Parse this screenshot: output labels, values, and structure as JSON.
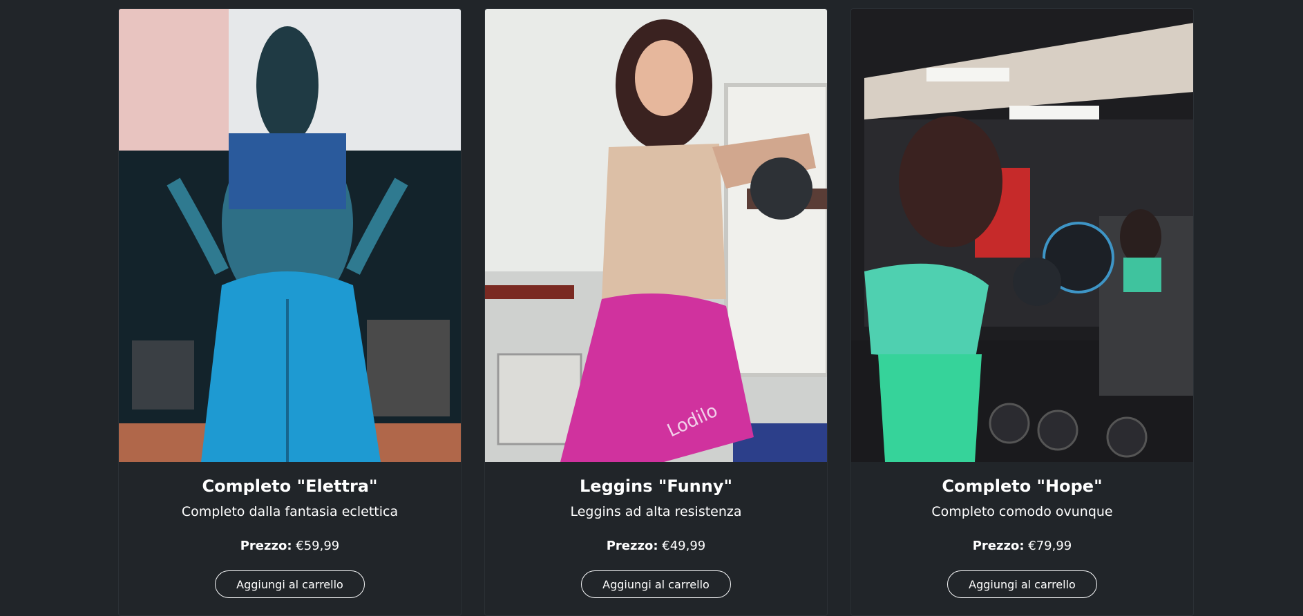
{
  "products": [
    {
      "title": "Completo \"Elettra\"",
      "description": "Completo dalla fantasia eclettica",
      "price_label": "Prezzo:",
      "price": "€59,99",
      "button_label": "Aggiungi al carrello"
    },
    {
      "title": "Leggins \"Funny\"",
      "description": "Leggins ad alta resistenza",
      "price_label": "Prezzo:",
      "price": "€49,99",
      "button_label": "Aggiungi al carrello",
      "photo_text": "Lodilo"
    },
    {
      "title": "Completo \"Hope\"",
      "description": "Completo comodo ovunque",
      "price_label": "Prezzo:",
      "price": "€79,99",
      "button_label": "Aggiungi al carrello"
    }
  ],
  "colors": {
    "page_background": "#212529",
    "text": "#ffffff",
    "button_border": "#f8f9fa"
  }
}
